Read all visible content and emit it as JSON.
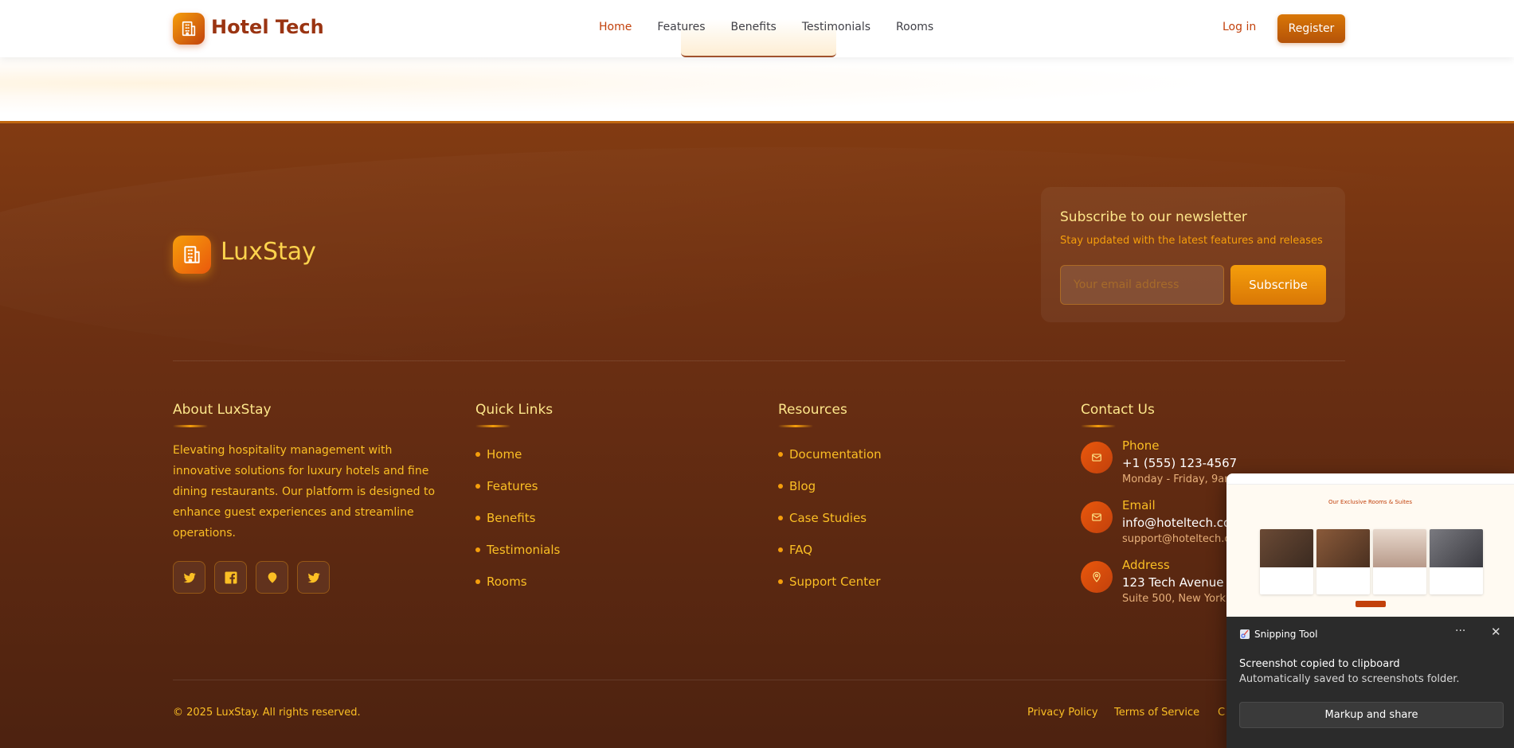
{
  "nav": {
    "brand": "Hotel Tech",
    "links": [
      "Home",
      "Features",
      "Benefits",
      "Testimonials",
      "Rooms"
    ],
    "active": "Home",
    "login": "Log in",
    "register": "Register"
  },
  "footer": {
    "brand": "LuxStay",
    "newsletter": {
      "title": "Subscribe to our newsletter",
      "subtitle": "Stay updated with the latest features and releases",
      "placeholder": "Your email address",
      "button": "Subscribe"
    },
    "about": {
      "title": "About LuxStay",
      "text": "Elevating hospitality management with innovative solutions for luxury hotels and fine dining restaurants. Our platform is designed to enhance guest experiences and streamline operations.",
      "socials": [
        "twitter-icon",
        "facebook-icon",
        "location-pin-icon",
        "twitter-icon"
      ]
    },
    "quick_links": {
      "title": "Quick Links",
      "items": [
        "Home",
        "Features",
        "Benefits",
        "Testimonials",
        "Rooms"
      ]
    },
    "resources": {
      "title": "Resources",
      "items": [
        "Documentation",
        "Blog",
        "Case Studies",
        "FAQ",
        "Support Center"
      ]
    },
    "contact": {
      "title": "Contact Us",
      "items": [
        {
          "icon": "mail-icon",
          "label": "Phone",
          "main": "+1 (555) 123-4567",
          "sub": "Monday - Friday, 9am"
        },
        {
          "icon": "mail-icon",
          "label": "Email",
          "main": "info@hoteltech.co",
          "sub": "support@hoteltech.c"
        },
        {
          "icon": "location-pin-icon",
          "label": "Address",
          "main": "123 Tech Avenue",
          "sub": "Suite 500, New York,"
        }
      ]
    },
    "copyright": "© 2025 LuxStay. All rights reserved.",
    "legal": [
      "Privacy Policy",
      "Terms of Service",
      "C"
    ]
  },
  "toast": {
    "app": "Snipping Tool",
    "message": "Screenshot copied to clipboard",
    "detail": "Automatically saved to screenshots folder.",
    "button": "Markup and share",
    "more": "···",
    "close": "✕",
    "preview_title": "Our Exclusive Rooms & Suites"
  },
  "colors": {
    "accent": "#c2410c",
    "amber": "#f59e0b",
    "footer_bg": "#6b2f12",
    "gold_text": "#fbbf24"
  }
}
